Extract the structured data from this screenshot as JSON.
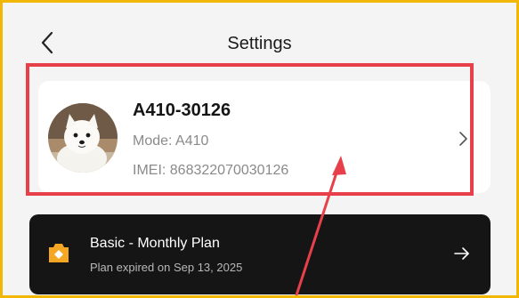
{
  "header": {
    "title": "Settings",
    "back_icon": "chevron-left-icon"
  },
  "device": {
    "name": "A410-30126",
    "mode": "Mode: A410",
    "imei": "IMEI: 868322070030126",
    "avatar": "dog-photo-avatar",
    "chevron_icon": "chevron-right-icon"
  },
  "plan": {
    "title": "Basic - Monthly Plan",
    "expiry": "Plan expired on Sep 13, 2025",
    "icon": "plan-badge-icon",
    "arrow_icon": "arrow-right-icon"
  },
  "colors": {
    "frame_border": "#f2b705",
    "annotation_red": "#e8404a",
    "plan_card_bg": "#151515",
    "plan_icon": "#f5a623"
  }
}
